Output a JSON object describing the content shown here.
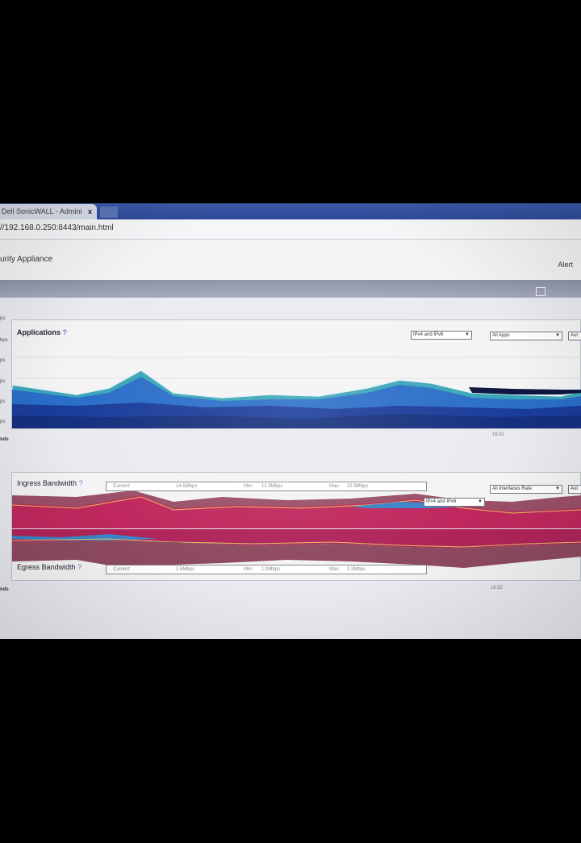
{
  "browser": {
    "tab_title": "Dell SonicWALL - Admini",
    "tab_close": "x",
    "url": "//192.168.0.250:8443/main.html"
  },
  "app": {
    "title": "urity Appliance",
    "alert_link": "Alert"
  },
  "applications_panel": {
    "title": "Applications",
    "help": "?",
    "ip_select": "IPv4 and IPv6",
    "apps_select": "All Apps",
    "extra_select": "Aut",
    "y_labels": [
      "ps",
      "bps",
      "ps",
      "ps",
      "ps",
      "ps"
    ],
    "x_tick": "16:52",
    "side_label": "nds"
  },
  "bandwidth_panel": {
    "ingress": {
      "title": "Ingress Bandwidth",
      "help": "?",
      "current_label": "Current:",
      "current_value": "14.5Mbps",
      "min_label": "Min:",
      "min_value": "12.9Mbps",
      "max_label": "Max:",
      "max_value": "22.9Mbps"
    },
    "egress": {
      "title": "Egress Bandwidth",
      "help": "?",
      "current_label": "Current:",
      "current_value": "1.5Mbps",
      "min_label": "Min:",
      "min_value": "1.0Mbps",
      "max_label": "Max:",
      "max_value": "2.3Mbps"
    },
    "interface_select": "All Interfaces Rate",
    "ip_select": "IPv4 and IPv6",
    "extra_select": "Aut",
    "x_tick": "16:52",
    "side_label": "nds"
  },
  "colors": {
    "apps_dark": "#1a3c9a",
    "apps_mid": "#2a6ec8",
    "apps_teal": "#3aa6b8",
    "bw_magenta": "#c0285e",
    "bw_mauve": "#9a5068",
    "bw_line": "#e0c060"
  }
}
